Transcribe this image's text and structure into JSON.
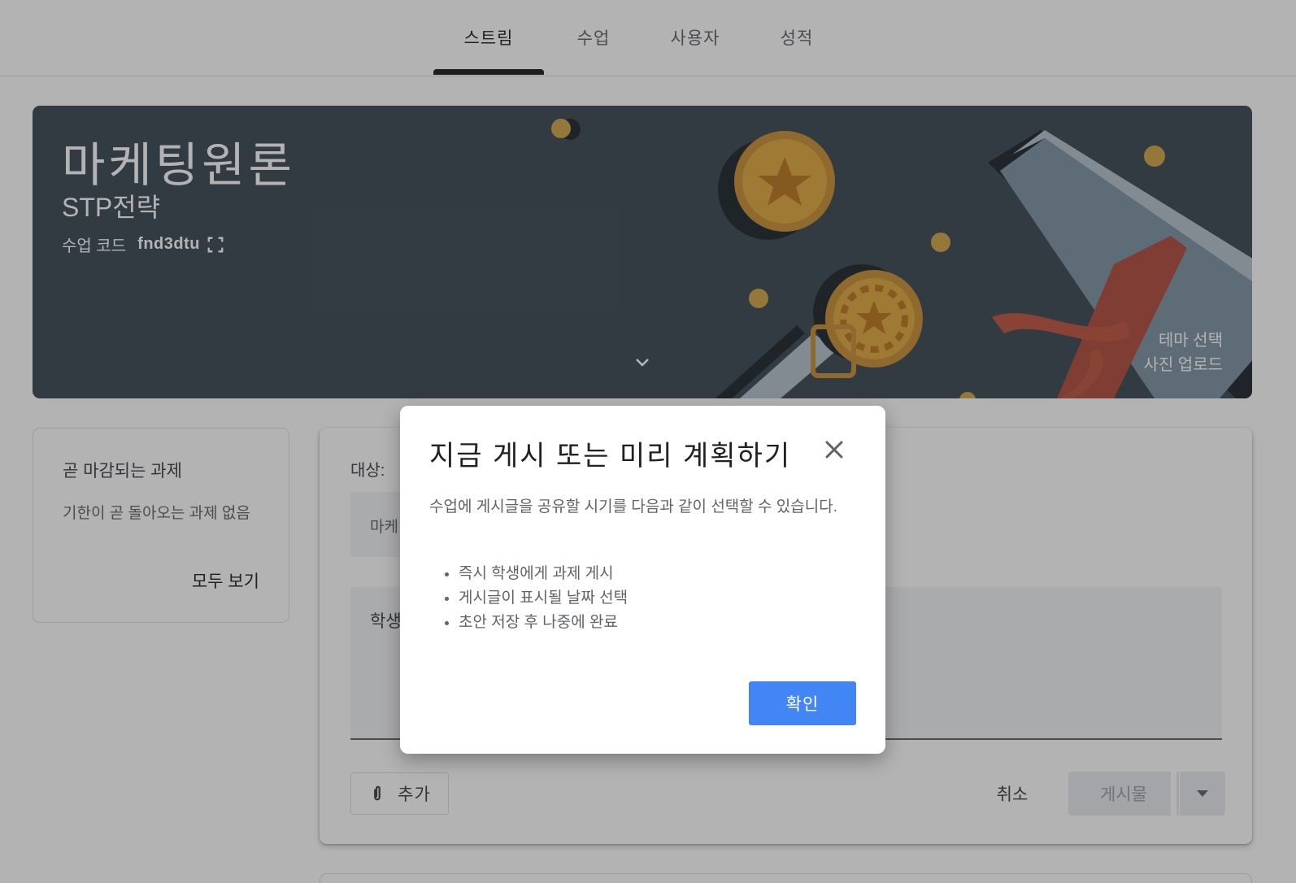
{
  "nav": {
    "tabs": [
      {
        "label": "스트림",
        "active": true
      },
      {
        "label": "수업",
        "active": false
      },
      {
        "label": "사용자",
        "active": false
      },
      {
        "label": "성적",
        "active": false
      }
    ]
  },
  "banner": {
    "title": "마케팅원론",
    "subtitle": "STP전략",
    "class_code_label": "수업 코드",
    "class_code": "fnd3dtu",
    "links": {
      "select_theme": "테마 선택",
      "upload_photo": "사진 업로드"
    },
    "background_color": "#3d4a52"
  },
  "due_card": {
    "title": "곧 마감되는 과제",
    "empty_text": "기한이 곧 돌아오는 과제 없음",
    "view_all": "모두 보기"
  },
  "compose": {
    "target_label": "대상:",
    "target_value": "마케",
    "textarea_placeholder": "학생",
    "add_button": "추가",
    "cancel_button": "취소",
    "post_button": "게시물"
  },
  "dialog": {
    "title": "지금 게시 또는 미리 계획하기",
    "body": "수업에 게시글을 공유할 시기를 다음과 같이 선택할 수 있습니다.",
    "options": [
      "즉시 학생에게 과제 게시",
      "게시글이 표시될 날짜 선택",
      "초안 저장 후 나중에 완료"
    ],
    "confirm_button": "확인",
    "accent_color": "#4285f4"
  }
}
